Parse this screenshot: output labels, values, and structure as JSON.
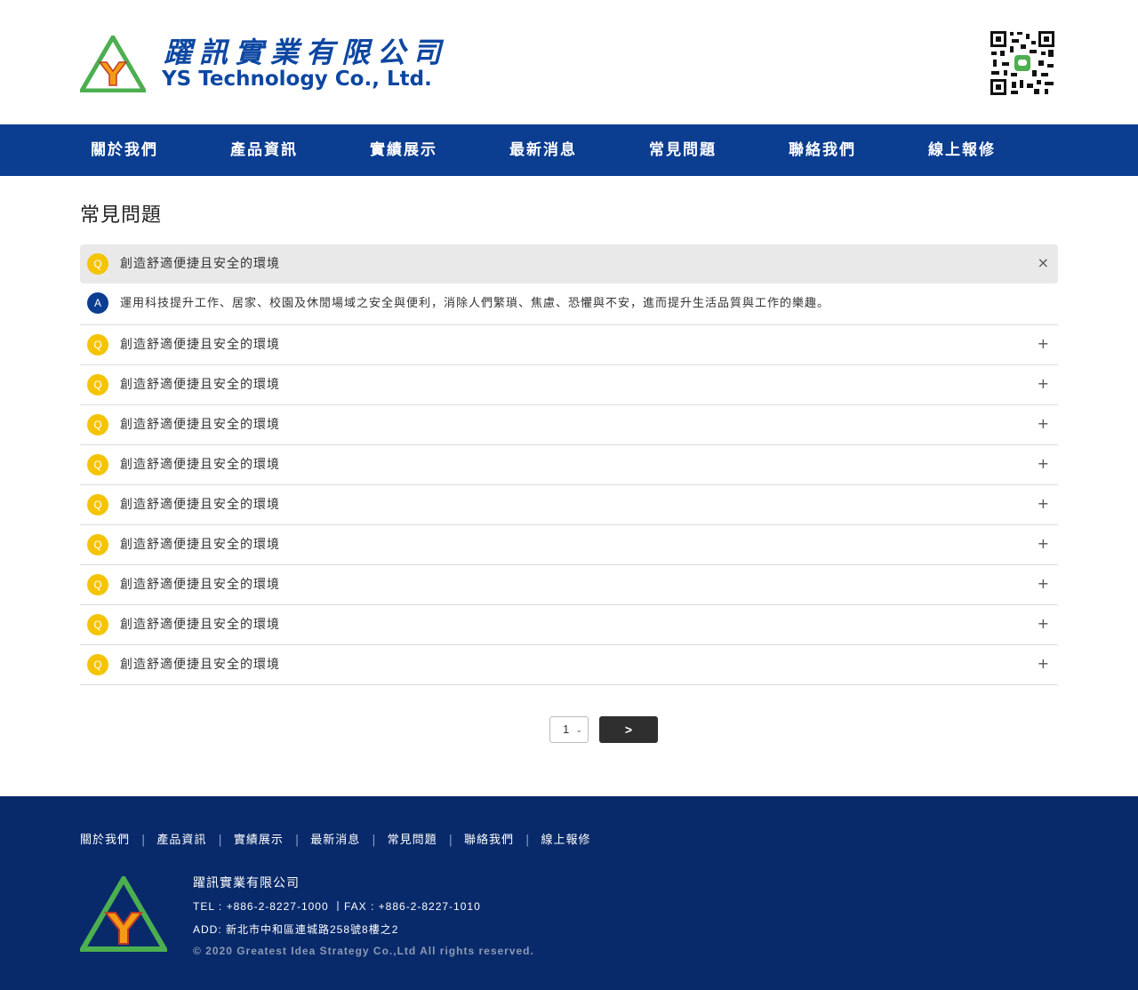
{
  "header": {
    "company_cn": "躍訊實業有限公司",
    "company_en": "YS Technology Co., Ltd.",
    "logo_letter": "Y"
  },
  "nav": {
    "items": [
      "關於我們",
      "產品資訊",
      "實績展示",
      "最新消息",
      "常見問題",
      "聯絡我們",
      "線上報修"
    ]
  },
  "main": {
    "title": "常見問題",
    "q_badge": "Q",
    "a_badge": "A",
    "faqs": [
      {
        "question": "創造舒適便捷且安全的環境",
        "open": true,
        "toggle": "×",
        "answer": "運用科技提升工作、居家、校園及休閒場域之安全與便利，消除人們繁瑣、焦慮、恐懼與不安，進而提升生活品質與工作的樂趣。"
      },
      {
        "question": "創造舒適便捷且安全的環境",
        "toggle": "+"
      },
      {
        "question": "創造舒適便捷且安全的環境",
        "toggle": "+"
      },
      {
        "question": "創造舒適便捷且安全的環境",
        "toggle": "+"
      },
      {
        "question": "創造舒適便捷且安全的環境",
        "toggle": "+"
      },
      {
        "question": "創造舒適便捷且安全的環境",
        "toggle": "+"
      },
      {
        "question": "創造舒適便捷且安全的環境",
        "toggle": "+"
      },
      {
        "question": "創造舒適便捷且安全的環境",
        "toggle": "+"
      },
      {
        "question": "創造舒適便捷且安全的環境",
        "toggle": "+"
      },
      {
        "question": "創造舒適便捷且安全的環境",
        "toggle": "+"
      }
    ]
  },
  "pager": {
    "page_value": "1",
    "next_label": ">"
  },
  "footer": {
    "nav": [
      "關於我們",
      "產品資訊",
      "實績展示",
      "最新消息",
      "常見問題",
      "聯絡我們",
      "線上報修"
    ],
    "separator": "|",
    "company": "躍訊實業有限公司",
    "tel_fax": "TEL : +886-2-8227-1000 丨FAX : +886-2-8227-1010",
    "address": "ADD: 新北市中和區連城路258號8樓之2",
    "copyright": "© 2020 Greatest Idea Strategy Co.,Ltd All rights reserved."
  },
  "colors": {
    "brand_blue": "#0b3d91",
    "footer_blue": "#082a6b",
    "badge_yellow": "#f5c400",
    "logo_green": "#4caf50",
    "logo_orange": "#f39c12"
  }
}
